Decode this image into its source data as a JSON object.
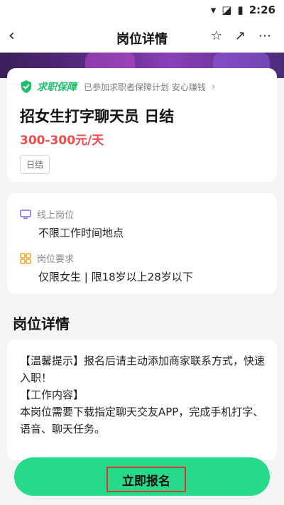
{
  "status_bar": {
    "time": "2:26"
  },
  "nav": {
    "back_icon": "‹",
    "title": "岗位详情",
    "star_icon": "☆",
    "share_icon": "↗",
    "more_icon": "⋯"
  },
  "protection": {
    "brand": "求职保障",
    "note": "已参加求职者保障计划 安心赚钱",
    "chevron": "›"
  },
  "job": {
    "title": "招女生打字聊天员 日结",
    "salary": "300-300元/天",
    "tag": "日结"
  },
  "info": [
    {
      "label": "线上岗位",
      "value": "不限工作时间地点",
      "icon": "monitor-icon"
    },
    {
      "label": "岗位要求",
      "value": "仅限女生 | 限18岁以上28岁以下",
      "icon": "grid-icon"
    }
  ],
  "detail": {
    "section_title": "岗位详情",
    "paragraphs": [
      "【温馨提示】报名后请主动添加商家联系方式，快速入职！",
      "【工作内容】",
      "本岗位需要下载指定聊天交友APP，完成手机打字、语音、聊天任务。"
    ]
  },
  "apply": {
    "label": "立即报名"
  },
  "colors": {
    "accent": "#27d98b",
    "salary": "#ef4b4b",
    "brand_green": "#1fbf6a"
  }
}
